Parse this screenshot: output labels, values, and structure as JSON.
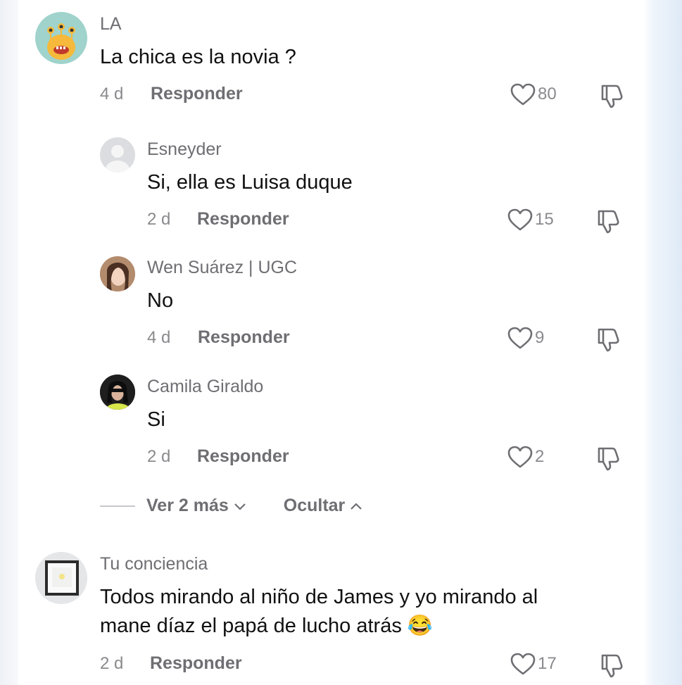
{
  "comments": [
    {
      "user": "LA",
      "text": "La chica es la novia ?",
      "time": "4 d",
      "reply": "Responder",
      "likes": "80"
    },
    {
      "user": "Esneyder",
      "text": "Si, ella es Luisa duque",
      "time": "2 d",
      "reply": "Responder",
      "likes": "15"
    },
    {
      "user": "Wen Suárez | UGC",
      "text": "No",
      "time": "4 d",
      "reply": "Responder",
      "likes": "9"
    },
    {
      "user": "Camila Giraldo",
      "text": "Si",
      "time": "2 d",
      "reply": "Responder",
      "likes": "2"
    },
    {
      "user": "Tu conciencia",
      "text_line1": "Todos mirando al niño de James y yo mirando al",
      "text_line2": "mane díaz el papá de lucho atrás 😂",
      "time": "2 d",
      "reply": "Responder",
      "likes": "17"
    }
  ],
  "replies_controls": {
    "view_more": "Ver 2 más",
    "hide": "Ocultar"
  },
  "icons": {
    "like": "heart-outline-icon",
    "dislike": "thumbs-down-icon",
    "expand": "chevron-down-icon",
    "collapse": "chevron-up-icon"
  },
  "colors": {
    "text": "#111111",
    "secondary": "#6e6e73",
    "muted": "#8a8a8e"
  }
}
